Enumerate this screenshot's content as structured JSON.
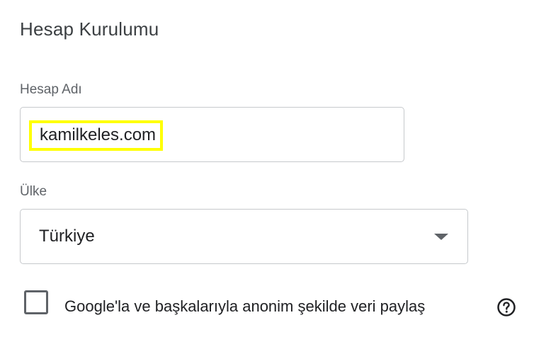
{
  "setup": {
    "title": "Hesap Kurulumu",
    "account_name_label": "Hesap Adı",
    "account_name_value": "kamilkeles.com",
    "country_label": "Ülke",
    "country_value": "Türkiye",
    "share_data_label": "Google'la ve başkalarıyla anonim şekilde veri paylaş",
    "share_data_checked": false
  },
  "icons": {
    "dropdown": "chevron-down-icon",
    "help": "help-circle-icon"
  },
  "colors": {
    "highlight": "#ffff00",
    "border": "#c6c9cc",
    "text": "#202124",
    "muted": "#5f6368"
  }
}
